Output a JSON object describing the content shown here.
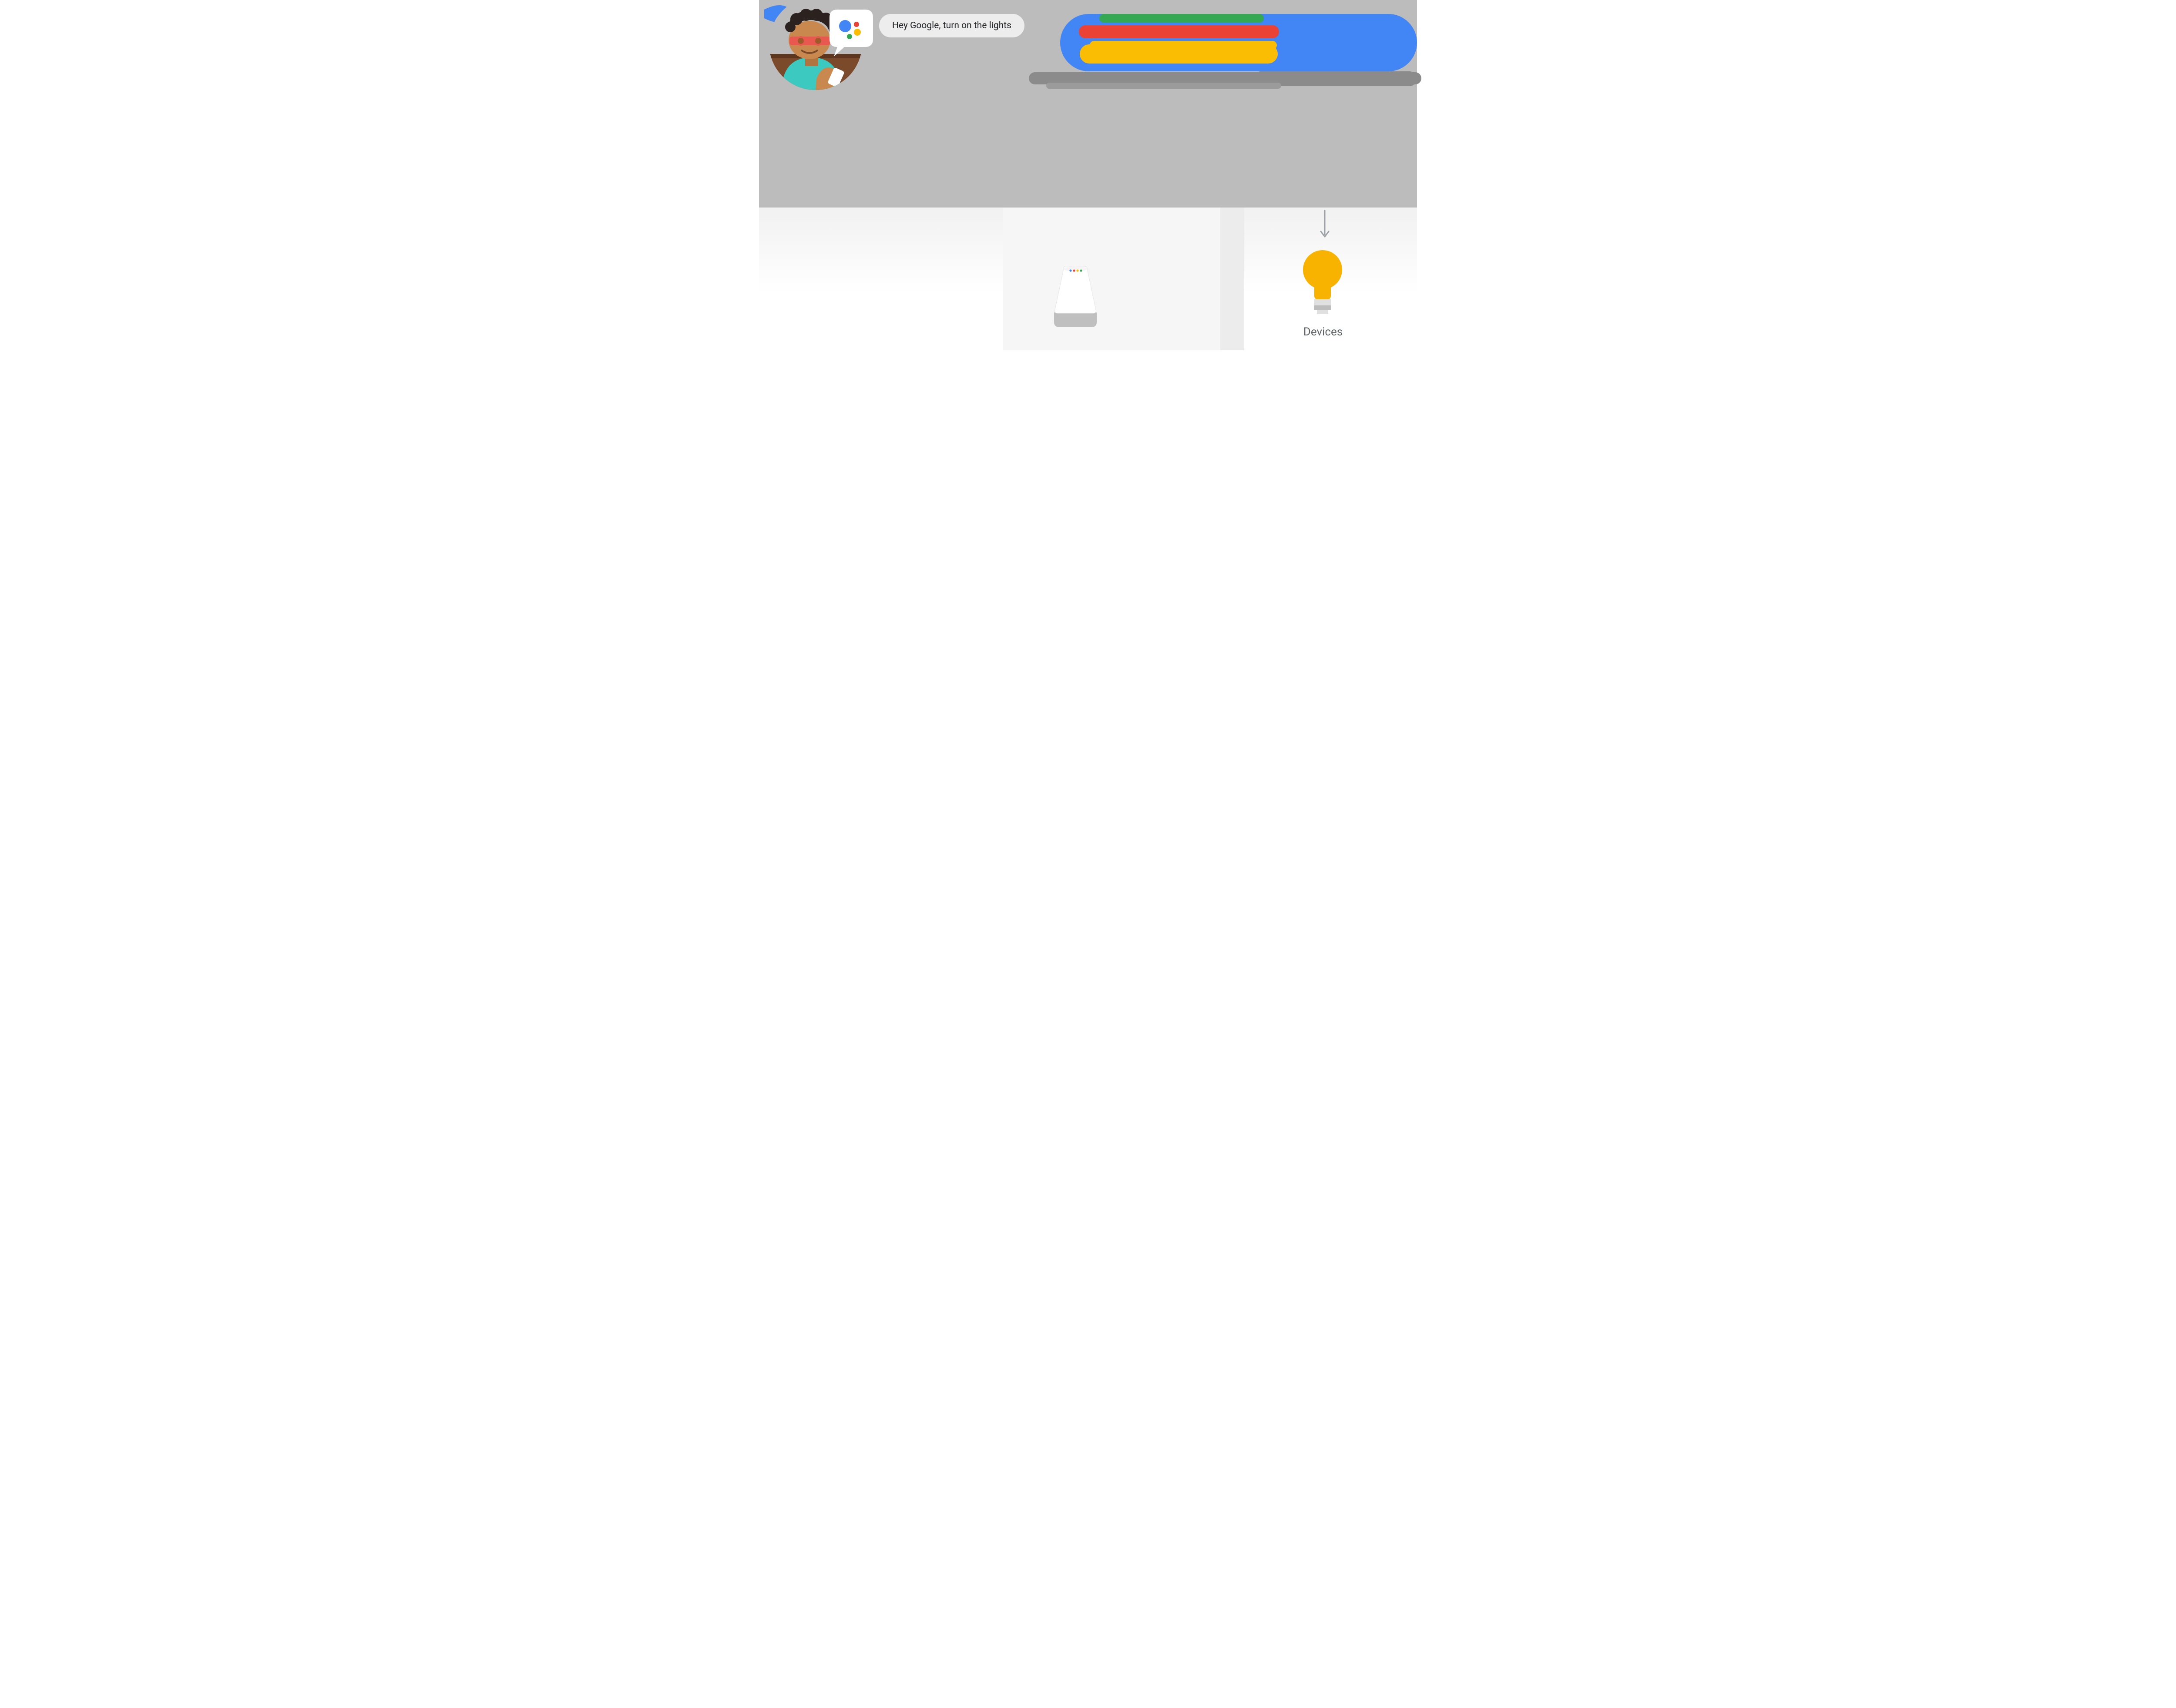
{
  "query": {
    "text": "Hey Google, turn on the lights"
  },
  "devices": {
    "label": "Devices"
  },
  "colors": {
    "blue": "#4285f4",
    "red": "#ea4335",
    "yellow": "#fbbc04",
    "green": "#34a853",
    "gray_motion": "#8b8b8b",
    "bulb": "#f8b200",
    "text_muted": "#5f6368"
  },
  "icons": {
    "assistant": "google-assistant-icon",
    "speaker": "google-home-speaker-icon",
    "bulb": "lightbulb-icon",
    "arrow": "arrow-down-icon",
    "user": "user-avatar-icon"
  }
}
